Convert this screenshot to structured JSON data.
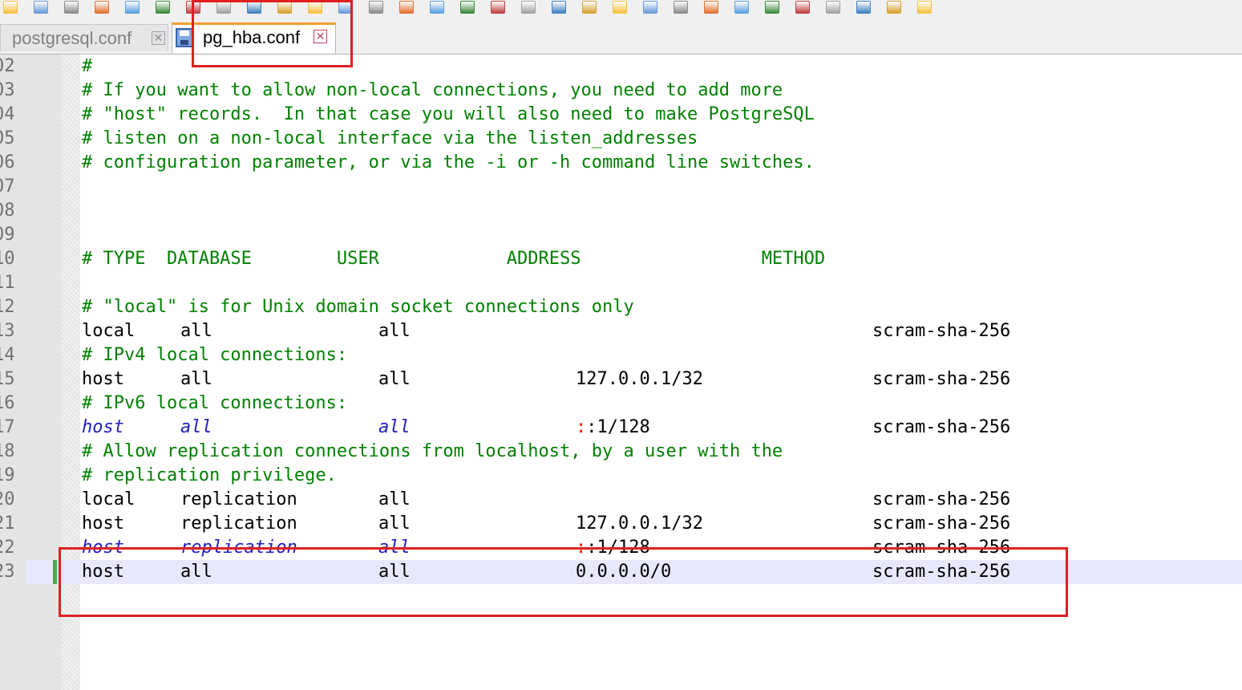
{
  "tabs": [
    {
      "label": "postgresql.conf",
      "active": false,
      "close": "✕"
    },
    {
      "label": "pg_hba.conf",
      "active": true,
      "close": "✕"
    }
  ],
  "lines": [
    {
      "num": "02",
      "text": "#"
    },
    {
      "num": "03",
      "text": "# If you want to allow non-local connections, you need to add more"
    },
    {
      "num": "04",
      "text": "# \"host\" records.  In that case you will also need to make PostgreSQL"
    },
    {
      "num": "05",
      "text": "# listen on a non-local interface via the listen_addresses"
    },
    {
      "num": "06",
      "text": "# configuration parameter, or via the -i or -h command line switches."
    },
    {
      "num": "07",
      "text": ""
    },
    {
      "num": "08",
      "text": ""
    },
    {
      "num": "09",
      "text": ""
    },
    {
      "num": "10",
      "text": "# TYPE  DATABASE        USER            ADDRESS                 METHOD"
    },
    {
      "num": "11",
      "text": ""
    },
    {
      "num": "12",
      "text": "# \"local\" is for Unix domain socket connections only"
    },
    {
      "num": "13",
      "type": "local",
      "database": "all",
      "user": "all",
      "address": "",
      "method": "scram-sha-256"
    },
    {
      "num": "14",
      "text": "# IPv4 local connections:"
    },
    {
      "num": "15",
      "type": "host",
      "database": "all",
      "user": "all",
      "address": "127.0.0.1/32",
      "method": "scram-sha-256"
    },
    {
      "num": "16",
      "text": "# IPv6 local connections:"
    },
    {
      "num": "17",
      "type": "host",
      "database": "all",
      "user": "all",
      "address_op": ":",
      "address": ":1/128",
      "method": "scram-sha-256"
    },
    {
      "num": "18",
      "text": "# Allow replication connections from localhost, by a user with the"
    },
    {
      "num": "19",
      "text": "# replication privilege."
    },
    {
      "num": "20",
      "type": "local",
      "database": "replication",
      "user": "all",
      "address": "",
      "method": "scram-sha-256"
    },
    {
      "num": "21",
      "type": "host",
      "database": "replication",
      "user": "all",
      "address": "127.0.0.1/32",
      "method": "scram-sha-256"
    },
    {
      "num": "22",
      "type": "host",
      "database": "replication",
      "user": "all",
      "address_op": ":",
      "address": ":1/128",
      "method": "scram-sha-256"
    },
    {
      "num": "23",
      "type": "host",
      "database": "all",
      "user": "all",
      "address": "0.0.0.0/0",
      "method": "scram-sha-256"
    }
  ],
  "colors": {
    "comment": "#008000",
    "disabled_keyword": "#2020c0",
    "operator": "#ff0000",
    "current_line": "#e8e8fc",
    "annotation": "#e02020",
    "changed_marker": "#4ea84e"
  },
  "toolbar_icons": [
    "new-file-icon",
    "open-file-icon",
    "save-icon",
    "save-all-icon",
    "close-icon",
    "close-all-icon",
    "print-icon",
    "cut-icon",
    "copy-icon",
    "paste-icon",
    "undo-icon",
    "redo-icon",
    "find-icon",
    "replace-icon",
    "zoom-in-icon",
    "zoom-out-icon",
    "sync-v-icon",
    "sync-h-icon",
    "wrap-icon",
    "show-all-icon",
    "indent-guide-icon",
    "udl-icon",
    "doc-map-icon",
    "function-list-icon",
    "folder-icon",
    "monitor-icon",
    "record-icon",
    "stop-icon",
    "play-icon",
    "run-macro-icon",
    "save-macro-icon"
  ]
}
